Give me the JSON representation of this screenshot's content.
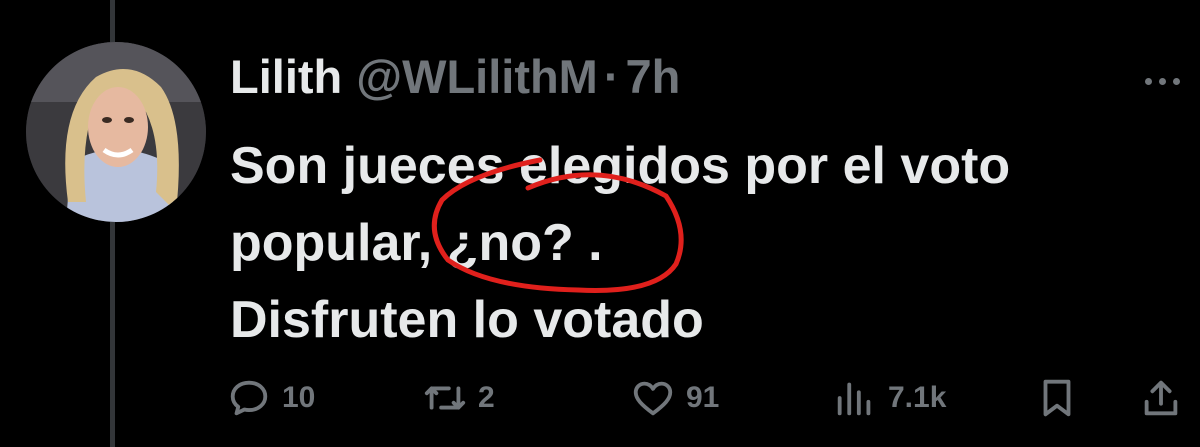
{
  "author": {
    "name": "Lilith",
    "handle": "@WLilithM",
    "separator": "·",
    "time": "7h"
  },
  "tweet": {
    "lines": [
      "Son jueces elegidos por el voto",
      "popular, ¿no? .",
      "Disfruten lo votado"
    ]
  },
  "actions": {
    "replies": "10",
    "reposts": "2",
    "likes": "91",
    "views": "7.1k"
  },
  "icons": {
    "reply": "reply-bubble-icon",
    "repost": "repost-arrows-icon",
    "like": "heart-icon",
    "views": "bar-chart-icon",
    "bookmark": "bookmark-icon",
    "share": "share-upload-icon",
    "more": "more-dots-icon"
  },
  "colors": {
    "background": "#000000",
    "text": "#e7e9ea",
    "muted": "#71767b",
    "annotation": "#e0201c"
  }
}
